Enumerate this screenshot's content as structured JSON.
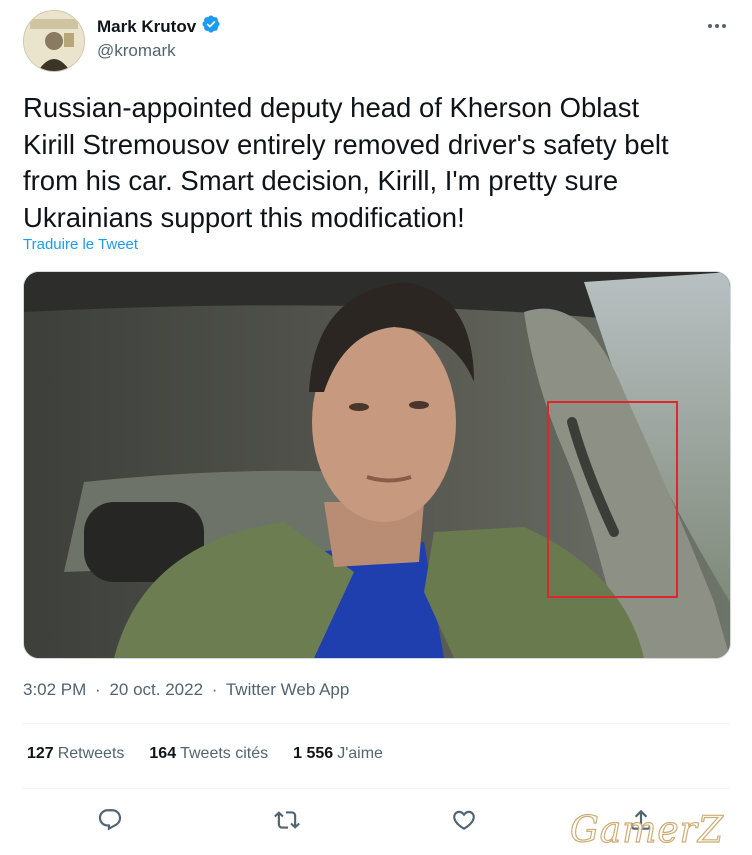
{
  "author": {
    "name": "Mark Krutov",
    "handle": "@kromark",
    "verified_icon": "verified-badge-icon",
    "accent_color": "#1d9bf0"
  },
  "tweet": {
    "text": "Russian-appointed deputy head of Kherson Oblast\nKirill Stremousov entirely removed driver's safety belt\nfrom his car. Smart decision, Kirill, I'm pretty sure\nUkrainians support this modification!",
    "translate_label": "Traduire le Tweet",
    "time": "3:02 PM",
    "date": "20 oct. 2022",
    "source": "Twitter Web App",
    "separator": "·"
  },
  "stats": {
    "retweets_count": "127",
    "retweets_label": "Retweets",
    "quotes_count": "164",
    "quotes_label": "Tweets cités",
    "likes_count": "1 556",
    "likes_label": "J'aime"
  },
  "actions": {
    "reply_icon": "reply-icon",
    "retweet_icon": "retweet-icon",
    "like_icon": "heart-icon",
    "share_icon": "share-icon"
  },
  "media": {
    "highlight_color": "#e0262b"
  },
  "watermark": {
    "text": "GamerZ"
  }
}
